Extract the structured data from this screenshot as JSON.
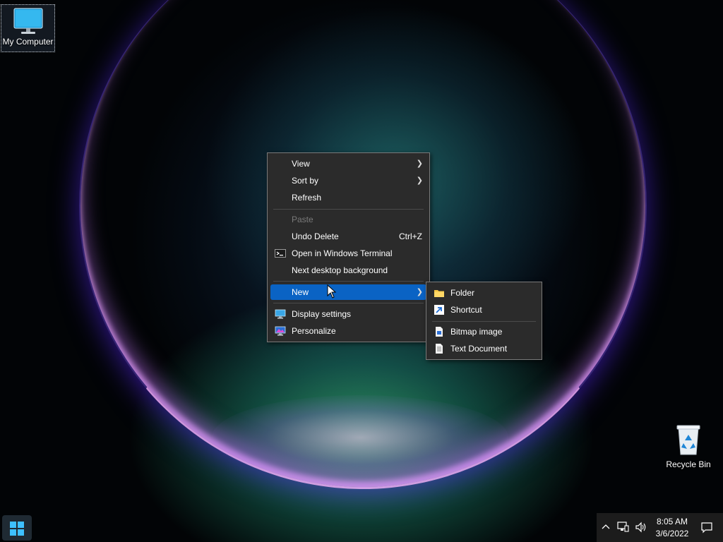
{
  "desktop": {
    "icons": [
      {
        "label": "My Computer",
        "icon": "monitor-icon"
      },
      {
        "label": "Recycle Bin",
        "icon": "recycle-bin-icon"
      }
    ]
  },
  "context_menu": {
    "items": [
      {
        "label": "View",
        "submenu": true
      },
      {
        "label": "Sort by",
        "submenu": true
      },
      {
        "label": "Refresh"
      },
      {
        "label": "Paste",
        "disabled": true
      },
      {
        "label": "Undo Delete",
        "shortcut": "Ctrl+Z"
      },
      {
        "label": "Open in Windows Terminal",
        "icon": "terminal-icon"
      },
      {
        "label": "Next desktop background"
      },
      {
        "label": "New",
        "submenu": true,
        "highlighted": true
      },
      {
        "label": "Display settings",
        "icon": "display-icon"
      },
      {
        "label": "Personalize",
        "icon": "personalize-icon"
      }
    ]
  },
  "new_submenu": {
    "items": [
      {
        "label": "Folder",
        "icon": "folder-icon"
      },
      {
        "label": "Shortcut",
        "icon": "shortcut-icon"
      },
      {
        "label": "Bitmap image",
        "icon": "bitmap-icon"
      },
      {
        "label": "Text Document",
        "icon": "text-document-icon"
      }
    ]
  },
  "taskbar": {
    "start_icon": "windows-logo-icon",
    "tray": {
      "icons": [
        "chevron-up-icon",
        "network-icon",
        "volume-icon",
        "notification-icon"
      ],
      "time": "8:05 AM",
      "date": "3/6/2022"
    }
  },
  "colors": {
    "menu_bg": "#2b2b2b",
    "highlight": "#0a63c4",
    "accent": "#3ec0ff"
  }
}
